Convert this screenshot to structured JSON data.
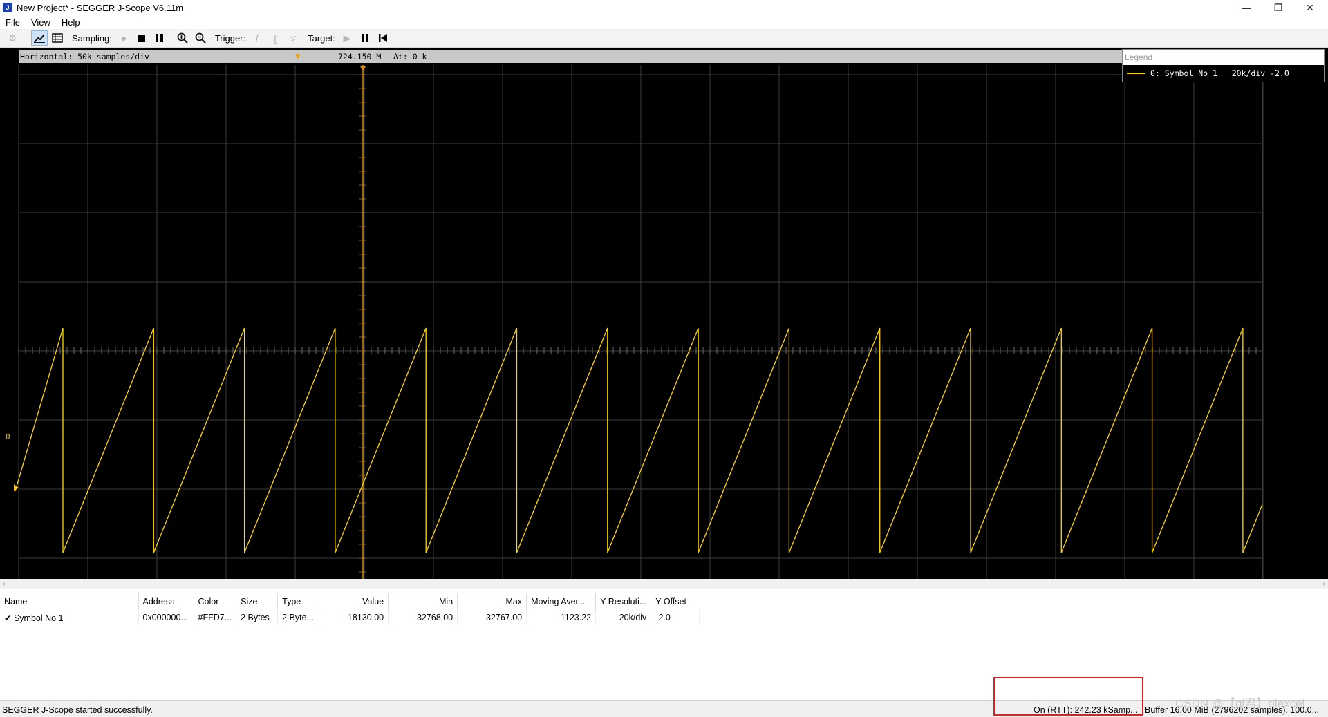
{
  "window": {
    "icon_text": "J",
    "title": "New Project* - SEGGER J-Scope V6.11m",
    "controls": [
      "—",
      "❐",
      "✕"
    ]
  },
  "menu": [
    "File",
    "View",
    "Help"
  ],
  "toolbar": {
    "sampling_label": "Sampling:",
    "trigger_label": "Trigger:",
    "target_label": "Target:"
  },
  "scope": {
    "horizontal": "Horizontal: 50k samples/div",
    "trigger_position": "724.150 M",
    "delta_t": "Δt: 0 k",
    "zero_label": "0",
    "legend_title": "Legend",
    "legend_entry": "0: Symbol No 1   20k/div -2.0",
    "trace_color": "#FFD700",
    "grid_color": "#3c3c3c"
  },
  "table": {
    "columns": [
      "Name",
      "Address",
      "Color",
      "Size",
      "Type",
      "Value",
      "Min",
      "Max",
      "Moving Aver...",
      "Y Resoluti...",
      "Y Offset"
    ],
    "rows": [
      [
        "✔ Symbol No 1",
        "0x000000...",
        "#FFD7...",
        "2 Bytes",
        "2 Byte...",
        "-18130.00",
        "-32768.00",
        "32767.00",
        "1123.22",
        "20k/div",
        "-2.0"
      ]
    ]
  },
  "status": {
    "message": "SEGGER J-Scope started successfully.",
    "rtt": "On (RTT): 242.23 kSamp...",
    "buffer": "Buffer 16.00 MiB (2796202 samples), 100.0...",
    "watermark": "CSDN @【qi君】qlexcel"
  },
  "chart_data": {
    "type": "line",
    "title": "",
    "series": [
      {
        "name": "Symbol No 1",
        "waveform": "sawtooth",
        "min": -32768,
        "max": 32767,
        "resolution": "20k/div",
        "offset": -2.0
      }
    ],
    "x_scale": "50k samples/div",
    "grid": true
  }
}
